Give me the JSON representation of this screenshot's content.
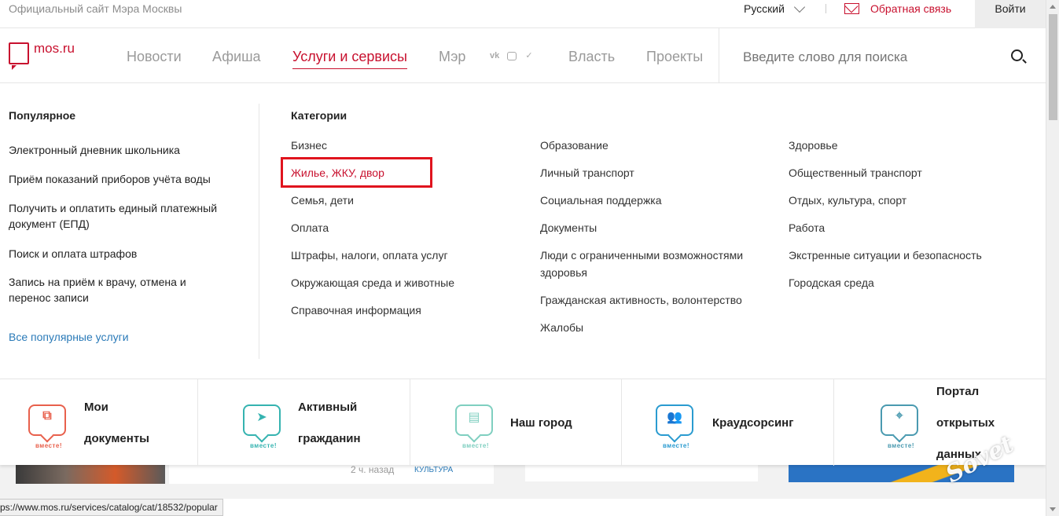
{
  "topbar": {
    "official_text": "Официальный сайт Мэра Москвы",
    "language": "Русский",
    "feedback": "Обратная связь",
    "login": "Войти"
  },
  "header": {
    "logo_text": "mos.ru",
    "nav": [
      "Новости",
      "Афиша",
      "Услуги и сервисы",
      "Мэр",
      "Власть",
      "Проекты"
    ],
    "active_nav": "Услуги и сервисы",
    "search_placeholder": "Введите слово для поиска"
  },
  "popular": {
    "title": "Популярное",
    "items": [
      "Электронный дневник школьника",
      "Приём показаний приборов учёта воды",
      "Получить и оплатить единый платежный документ (ЕПД)",
      "Поиск и оплата штрафов",
      "Запись на приём к врачу, отмена и перенос записи"
    ],
    "all_link": "Все популярные услуги"
  },
  "categories": {
    "title": "Категории",
    "col1": [
      "Бизнес",
      "Жилье, ЖКУ, двор",
      "Семья, дети",
      "Оплата",
      "Штрафы, налоги, оплата услуг",
      "Окружающая среда и животные",
      "Справочная информация"
    ],
    "col2": [
      "Образование",
      "Личный транспорт",
      "Социальная поддержка",
      "Документы",
      "Люди с ограниченными возможностями здоровья",
      "Гражданская активность, волонтерство",
      "Жалобы"
    ],
    "col3": [
      "Здоровье",
      "Общественный транспорт",
      "Отдых, культура, спорт",
      "Работа",
      "Экстренные ситуации и безопасность",
      "Городская среда"
    ],
    "highlighted": "Жилье, ЖКУ, двор"
  },
  "tiles": [
    {
      "label": "Мои документы",
      "badge": "вместе!",
      "color": "#e8604c"
    },
    {
      "label": "Активный гражданин",
      "badge": "вместе!",
      "color": "#35b3b0"
    },
    {
      "label": "Наш город",
      "badge": "вместе!",
      "color": "#7fcfc0"
    },
    {
      "label": "Краудсорсинг",
      "badge": "вместе!",
      "color": "#2a9bd0"
    },
    {
      "label": "Портал открытых данных",
      "badge": "вместе!",
      "color": "#4a9ab0"
    }
  ],
  "peek": {
    "time": "2 ч. назад",
    "tag": "КУЛЬТУРА"
  },
  "status_url": "ps://www.mos.ru/services/catalog/cat/18532/popular",
  "colors": {
    "brand_red": "#c8102e",
    "highlight_box": "#e0141e",
    "link_blue": "#2a7ab8"
  }
}
